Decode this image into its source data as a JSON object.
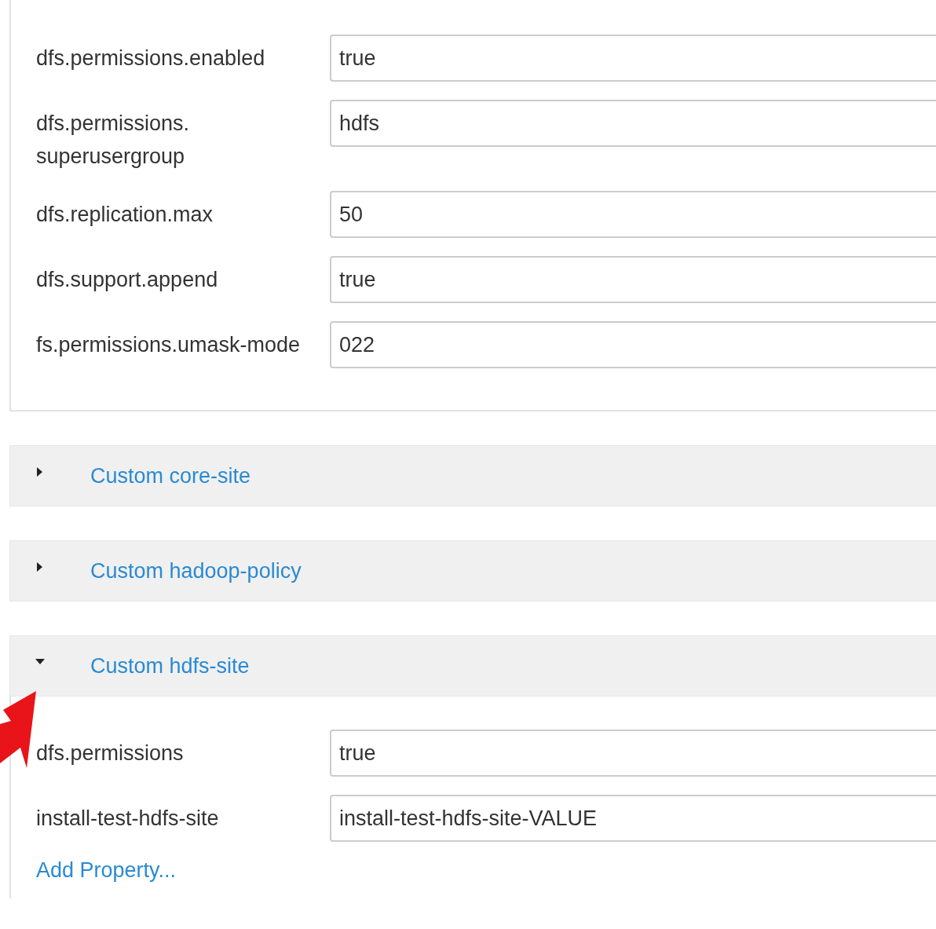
{
  "config_fields": [
    {
      "label": "dfs.permissions.enabled",
      "value": "true"
    },
    {
      "label": "dfs.permissions. superusergroup",
      "value": "hdfs"
    },
    {
      "label": "dfs.replication.max",
      "value": "50"
    },
    {
      "label": "dfs.support.append",
      "value": "true"
    },
    {
      "label": "fs.permissions.umask-mode",
      "value": "022"
    }
  ],
  "sections": [
    {
      "title": "Custom core-site",
      "expanded": false
    },
    {
      "title": "Custom hadoop-policy",
      "expanded": false
    },
    {
      "title": "Custom hdfs-site",
      "expanded": true,
      "fields": [
        {
          "label": "dfs.permissions",
          "value": "true"
        },
        {
          "label": "install-test-hdfs-site",
          "value": "install-test-hdfs-site-VALUE"
        }
      ],
      "add_link": "Add Property..."
    }
  ]
}
